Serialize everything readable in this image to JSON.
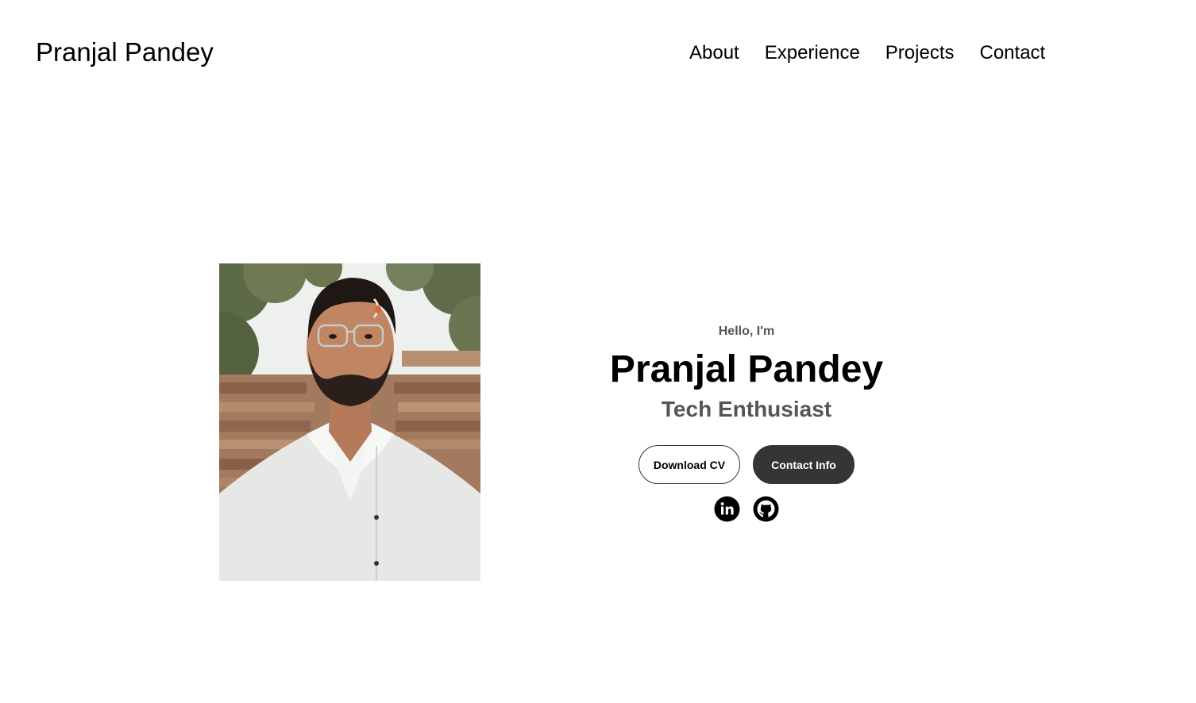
{
  "nav": {
    "logo": "Pranjal Pandey",
    "links": [
      {
        "label": "About"
      },
      {
        "label": "Experience"
      },
      {
        "label": "Projects"
      },
      {
        "label": "Contact"
      }
    ]
  },
  "hero": {
    "greeting": "Hello, I'm",
    "name": "Pranjal Pandey",
    "subtitle": "Tech Enthusiast",
    "buttons": {
      "download_cv": "Download CV",
      "contact_info": "Contact Info"
    },
    "socials": [
      {
        "icon": "linkedin-icon"
      },
      {
        "icon": "github-icon"
      }
    ],
    "photo_alt": "profile photo"
  },
  "colors": {
    "text_primary": "#000000",
    "text_secondary": "#555555",
    "button_dark": "#353535",
    "background": "#ffffff"
  }
}
